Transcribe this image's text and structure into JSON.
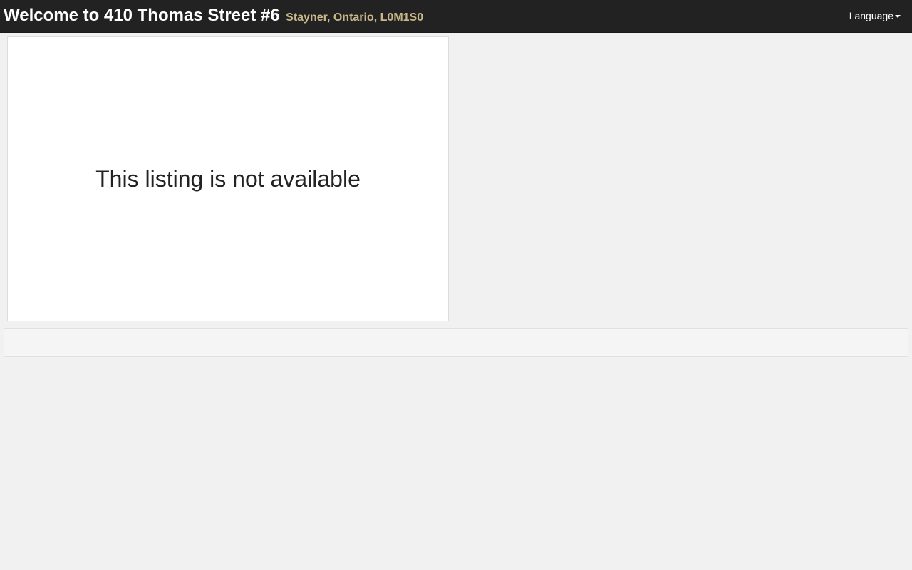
{
  "header": {
    "title": "Welcome to 410 Thomas Street #6",
    "subtitle": "Stayner, Ontario, L0M1S0",
    "language_label": "Language",
    "language_icon": "caret-down-icon"
  },
  "main": {
    "message": "This listing is not available"
  },
  "colors": {
    "header_bg": "#222222",
    "subtitle": "#c8b78a",
    "page_bg": "#f1f1f1"
  }
}
